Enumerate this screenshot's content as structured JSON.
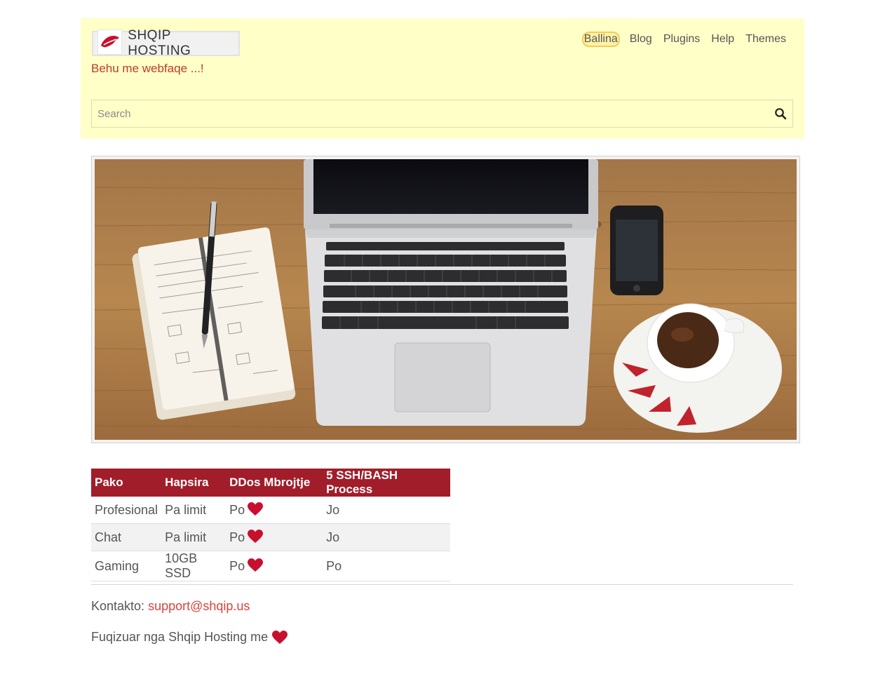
{
  "colors": {
    "header_bg": "#ffffc8",
    "table_header_bg": "#a11d2a",
    "accent_red": "#c0392b",
    "heart_red": "#c8102e"
  },
  "header": {
    "brand_name": "SHQIP HOSTING",
    "logo_icon": "leaf-lips-icon",
    "tagline": "Behu me webfaqe ...!",
    "nav": [
      {
        "label": "Ballina",
        "active": true
      },
      {
        "label": "Blog",
        "active": false
      },
      {
        "label": "Plugins",
        "active": false
      },
      {
        "label": "Help",
        "active": false
      },
      {
        "label": "Themes",
        "active": false
      }
    ],
    "search": {
      "placeholder": "Search",
      "value": "",
      "icon": "search-icon"
    }
  },
  "hero": {
    "icon": "laptop-desk-photo"
  },
  "table": {
    "headers": [
      "Pako",
      "Hapsira",
      "DDos Mbrojtje",
      "5 SSH/BASH Process"
    ],
    "rows": [
      {
        "pako": "Profesional",
        "hapsira": "Pa limit",
        "ddos": "Po",
        "ssh": "Jo"
      },
      {
        "pako": "Chat",
        "hapsira": "Pa limit",
        "ddos": "Po",
        "ssh": "Jo"
      },
      {
        "pako": "Gaming",
        "hapsira": "10GB SSD",
        "ddos": "Po",
        "ssh": "Po"
      }
    ]
  },
  "footer": {
    "contact_label": "Kontakto:",
    "contact_email": "support@shqip.us",
    "powered_text": "Fuqizuar nga Shqip Hosting me"
  }
}
